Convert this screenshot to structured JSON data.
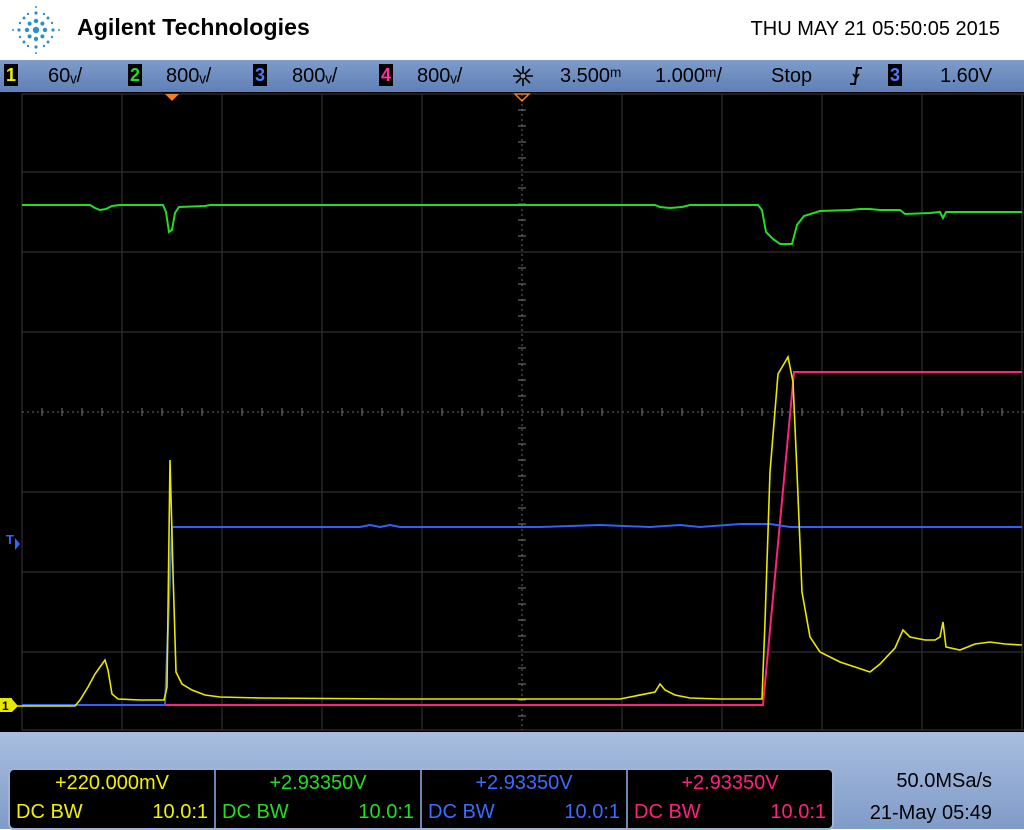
{
  "header": {
    "brand": "Agilent Technologies",
    "datetime": "THU MAY 21 05:50:05 2015"
  },
  "statusbar": {
    "ch1": {
      "num": "1",
      "scale": "60ᵥ/",
      "color": "#f0f000"
    },
    "ch2": {
      "num": "2",
      "scale": "800ᵥ/",
      "color": "#22cc22"
    },
    "ch3": {
      "num": "3",
      "scale": "800ᵥ/",
      "color": "#3366ff"
    },
    "ch4": {
      "num": "4",
      "scale": "800ᵥ/",
      "color": "#ff2080"
    },
    "delay": "3.500ᵐ",
    "timebase": "1.000ᵐ/",
    "run_state": "Stop",
    "trigger_source": "3",
    "trigger_level": "1.60V"
  },
  "measurements": [
    {
      "value": "+220.000mV",
      "coupling": "DC BW",
      "ratio": "10.0:1",
      "color": "#f0f000"
    },
    {
      "value": "+2.93350V",
      "coupling": "DC BW",
      "ratio": "10.0:1",
      "color": "#22cc22"
    },
    {
      "value": "+2.93350V",
      "coupling": "DC BW",
      "ratio": "10.0:1",
      "color": "#3366ff"
    },
    {
      "value": "+2.93350V",
      "coupling": "DC BW",
      "ratio": "10.0:1",
      "color": "#ff2080"
    }
  ],
  "acquisition": {
    "sample_rate": "50.0MSa/s",
    "timestamp": "21-May 05:49"
  },
  "markers": {
    "trigger_label": "T",
    "ground_label": "1"
  }
}
